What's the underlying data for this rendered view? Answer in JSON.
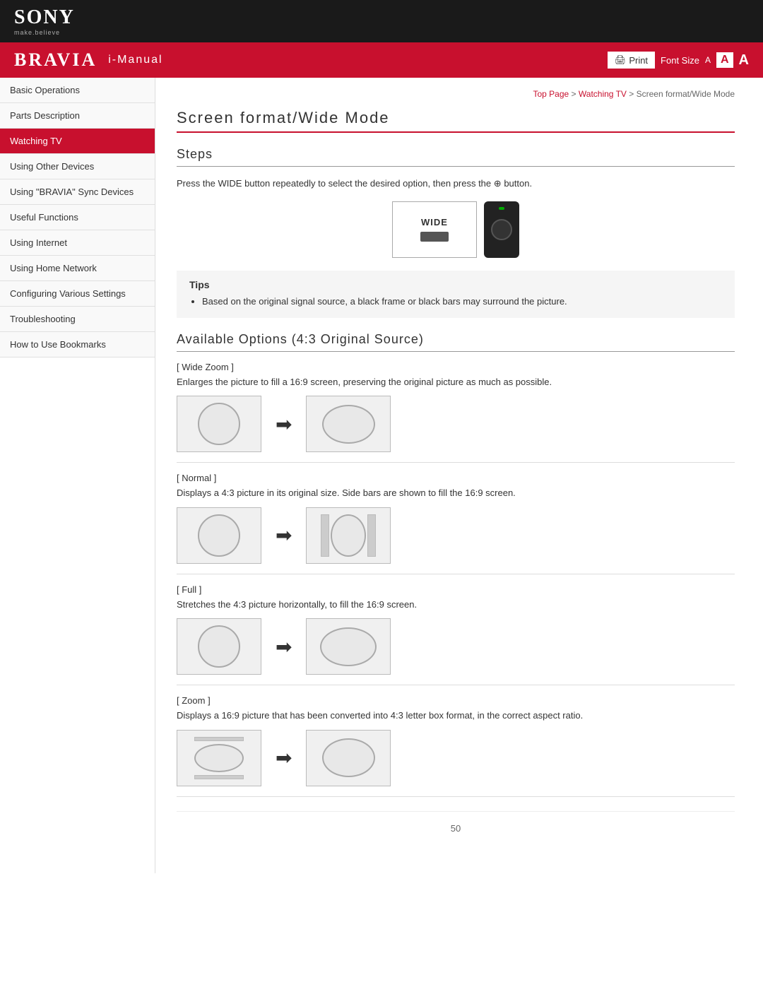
{
  "header": {
    "sony_logo": "SONY",
    "sony_tagline": "make.believe"
  },
  "toolbar": {
    "bravia": "BRAVIA",
    "imanual": "i-Manual",
    "print_label": "Print",
    "font_size_label": "Font Size",
    "font_a_small": "A",
    "font_a_medium": "A",
    "font_a_large": "A"
  },
  "breadcrumb": {
    "top_page": "Top Page",
    "separator1": " > ",
    "watching_tv": "Watching TV",
    "separator2": " > ",
    "current": "Screen format/Wide Mode"
  },
  "page_title": "Screen format/Wide Mode",
  "steps": {
    "heading": "Steps",
    "text": "Press the WIDE button repeatedly to select the desired option, then press the",
    "button_symbol": "⊕",
    "text_end": "button.",
    "wide_label": "WIDE"
  },
  "tips": {
    "title": "Tips",
    "item1": "Based on the original signal source, a black frame or black bars may surround the picture."
  },
  "available_options": {
    "heading": "Available Options (4:3 Original Source)",
    "options": [
      {
        "label": "[ Wide Zoom ]",
        "desc": "Enlarges the picture to fill a 16:9 screen, preserving the original picture as much as possible.",
        "type": "wide-zoom"
      },
      {
        "label": "[ Normal ]",
        "desc": "Displays a 4:3 picture in its original size. Side bars are shown to fill the 16:9 screen.",
        "type": "normal"
      },
      {
        "label": "[ Full ]",
        "desc": "Stretches the 4:3 picture horizontally, to fill the 16:9 screen.",
        "type": "full"
      },
      {
        "label": "[ Zoom ]",
        "desc": "Displays a 16:9 picture that has been converted into 4:3 letter box format, in the correct aspect ratio.",
        "type": "zoom"
      }
    ]
  },
  "sidebar": {
    "items": [
      {
        "label": "Basic Operations",
        "active": false
      },
      {
        "label": "Parts Description",
        "active": false
      },
      {
        "label": "Watching TV",
        "active": true
      },
      {
        "label": "Using Other Devices",
        "active": false
      },
      {
        "label": "Using \"BRAVIA\" Sync Devices",
        "active": false
      },
      {
        "label": "Useful Functions",
        "active": false
      },
      {
        "label": "Using Internet",
        "active": false
      },
      {
        "label": "Using Home Network",
        "active": false
      },
      {
        "label": "Configuring Various Settings",
        "active": false
      },
      {
        "label": "Troubleshooting",
        "active": false
      },
      {
        "label": "How to Use Bookmarks",
        "active": false
      }
    ]
  },
  "footer": {
    "page_number": "50"
  }
}
